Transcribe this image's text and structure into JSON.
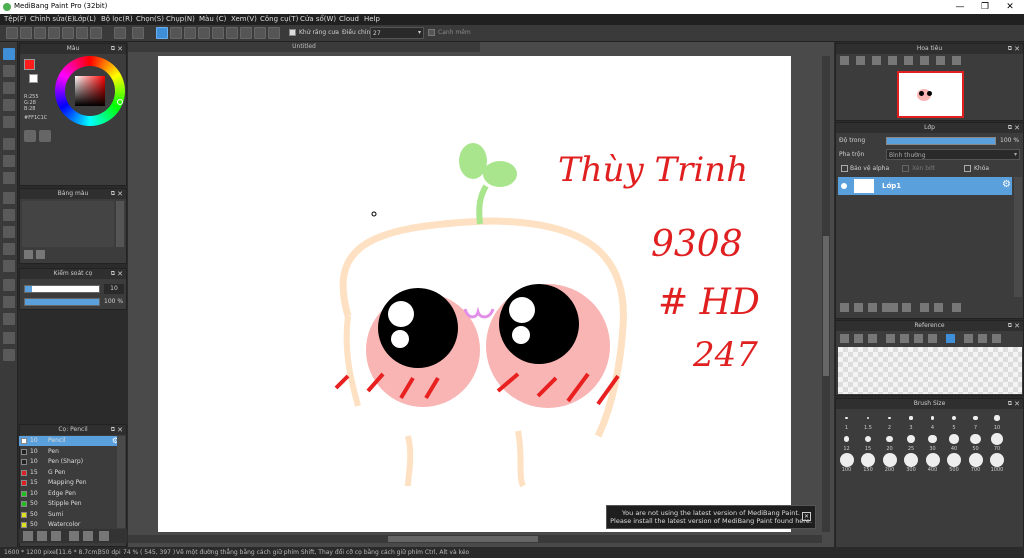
{
  "window": {
    "title": "MediBang Paint Pro (32bit)",
    "min": "—",
    "max": "❐",
    "close": "✕"
  },
  "menu": [
    "Tệp(F)",
    "Chỉnh sửa(E)",
    "Lớp(L)",
    "Bộ lọc(R)",
    "Chọn(S)",
    "Chụp(N)",
    "Màu (C)",
    "Xem(V)",
    "Công cụ(T)",
    "Cửa sổ(W)",
    "Cloud",
    "Help"
  ],
  "toolbar": {
    "antialias_label": "Khử răng cưa",
    "adjust_label": "Điều chỉnh",
    "adjust_value": "27",
    "smooth_label": "Cạnh mềm"
  },
  "color_panel": {
    "title": "Màu",
    "r": "R:255",
    "g": "G:28",
    "b": "B:28",
    "hex": "#FF1C1C",
    "primary": "#ff1c1c"
  },
  "palette_panel": {
    "title": "Bảng màu"
  },
  "brush_control": {
    "title": "Kiểm soát cọ",
    "size_value": "10",
    "opacity_value": "100 %",
    "size_fraction": 0.1,
    "opacity_fraction": 1.0
  },
  "brush_panel": {
    "title": "Cọ: Pencil",
    "items": [
      {
        "size": "10",
        "name": "Pencil",
        "color": "#ffffff"
      },
      {
        "size": "10",
        "name": "Pen",
        "color": "#222222"
      },
      {
        "size": "10",
        "name": "Pen (Sharp)",
        "color": "#222222"
      },
      {
        "size": "15",
        "name": "G Pen",
        "color": "#e02020"
      },
      {
        "size": "15",
        "name": "Mapping Pen",
        "color": "#e02020"
      },
      {
        "size": "10",
        "name": "Edge Pen",
        "color": "#20c020"
      },
      {
        "size": "50",
        "name": "Stipple Pen",
        "color": "#20c020"
      },
      {
        "size": "50",
        "name": "Sumi",
        "color": "#e0e020"
      },
      {
        "size": "50",
        "name": "Watercolor",
        "color": "#e0e020"
      }
    ]
  },
  "document": {
    "tab": "Untitled"
  },
  "artwork": {
    "name": "Thùy Trinh",
    "number": "9308",
    "tag": "# HD",
    "num2": "247"
  },
  "navigator_panel": {
    "title": "Hoa tiêu"
  },
  "layer_panel": {
    "title": "Lớp",
    "opacity_label": "Độ trong",
    "opacity_value": "100 %",
    "blend_label": "Pha trộn",
    "blend_value": "Bình thường",
    "protect_alpha": "Bảo vệ alpha",
    "clip": "Xén bớt",
    "lock": "Khóa",
    "layer_name": "Lớp1"
  },
  "reference_panel": {
    "title": "Reference"
  },
  "brush_size_panel": {
    "title": "Brush Size",
    "sizes": [
      "1",
      "1.5",
      "2",
      "3",
      "4",
      "5",
      "7",
      "10",
      "12",
      "15",
      "20",
      "25",
      "30",
      "40",
      "50",
      "70",
      "100",
      "150",
      "200",
      "300",
      "400",
      "500",
      "700",
      "1000"
    ]
  },
  "status": {
    "size": "1600 * 1200 pixel",
    "cm": "(11.6 * 8.7cm)",
    "dpi": "350 dpi",
    "zoom": "74 %",
    "coords": "( 545, 397 )",
    "hint": "Vẽ một đường thẳng bằng cách giữ phím Shift, Thay đổi cỡ cọ bằng cách giữ phím Ctrl, Alt và kéo"
  },
  "notice": {
    "line1": "You are not using the latest version of MediBang Paint.",
    "line2": "Please install the latest version of MediBang Paint found here.",
    "close": "✕"
  }
}
